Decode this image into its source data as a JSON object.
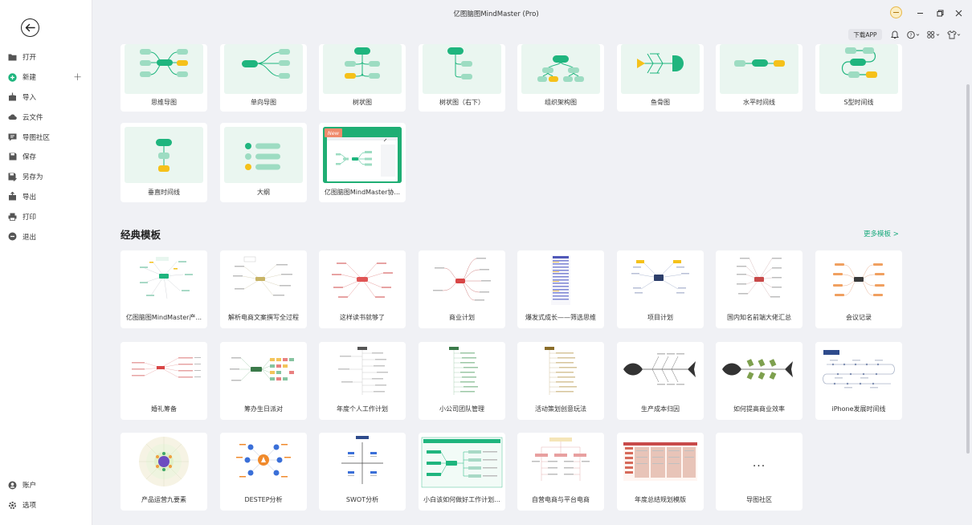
{
  "app": {
    "title": "亿图脑图MindMaster (Pro)"
  },
  "sidebar": {
    "items": [
      {
        "label": "打开",
        "icon": "folder-icon"
      },
      {
        "label": "新建",
        "icon": "plus-circle-icon"
      },
      {
        "label": "导入",
        "icon": "import-icon"
      },
      {
        "label": "云文件",
        "icon": "cloud-icon"
      },
      {
        "label": "导图社区",
        "icon": "community-icon"
      },
      {
        "label": "保存",
        "icon": "save-icon"
      },
      {
        "label": "另存为",
        "icon": "save-as-icon"
      },
      {
        "label": "导出",
        "icon": "export-icon"
      },
      {
        "label": "打印",
        "icon": "printer-icon"
      },
      {
        "label": "退出",
        "icon": "exit-icon"
      }
    ],
    "bottom_items": [
      {
        "label": "账户",
        "icon": "account-icon"
      },
      {
        "label": "选项",
        "icon": "gear-icon"
      }
    ]
  },
  "toolbar": {
    "download_label": "下载APP"
  },
  "layouts": [
    {
      "label": "思维导图"
    },
    {
      "label": "单向导图"
    },
    {
      "label": "树状图"
    },
    {
      "label": "树状图（右下）"
    },
    {
      "label": "组织架构图"
    },
    {
      "label": "鱼骨图"
    },
    {
      "label": "水平时间线"
    },
    {
      "label": "S型时间线"
    },
    {
      "label": "垂直时间线"
    },
    {
      "label": "大纲"
    },
    {
      "label": "亿图脑图MindMaster协...",
      "badge": "New"
    }
  ],
  "templates_section": {
    "title": "经典模板",
    "more_label": "更多模板 >"
  },
  "templates": [
    {
      "label": "亿图脑图MindMaster产..."
    },
    {
      "label": "解析电商文案撰写全过程"
    },
    {
      "label": "这样读书就够了"
    },
    {
      "label": "商业计划"
    },
    {
      "label": "爆发式成长——筛选思维"
    },
    {
      "label": "项目计划"
    },
    {
      "label": "国内知名前端大佬汇总"
    },
    {
      "label": "会议记录"
    },
    {
      "label": "婚礼筹备"
    },
    {
      "label": "筹办生日派对"
    },
    {
      "label": "年度个人工作计划"
    },
    {
      "label": "小公司团队管理"
    },
    {
      "label": "活动策划创意玩法"
    },
    {
      "label": "生产成本归因"
    },
    {
      "label": "如何提高商业效率"
    },
    {
      "label": "iPhone发展时间线"
    },
    {
      "label": "产品运营九要素"
    },
    {
      "label": "DESTEP分析"
    },
    {
      "label": "SWOT分析"
    },
    {
      "label": "小白该如何做好工作计划..."
    },
    {
      "label": "自营电商与平台电商"
    },
    {
      "label": "年度总结规划模版"
    },
    {
      "label": "导图社区",
      "more": "..."
    }
  ],
  "colors": {
    "accent": "#18a97c",
    "node_green": "#1fb57e",
    "node_light": "#9ddcc2",
    "node_yellow": "#f5c11a"
  }
}
